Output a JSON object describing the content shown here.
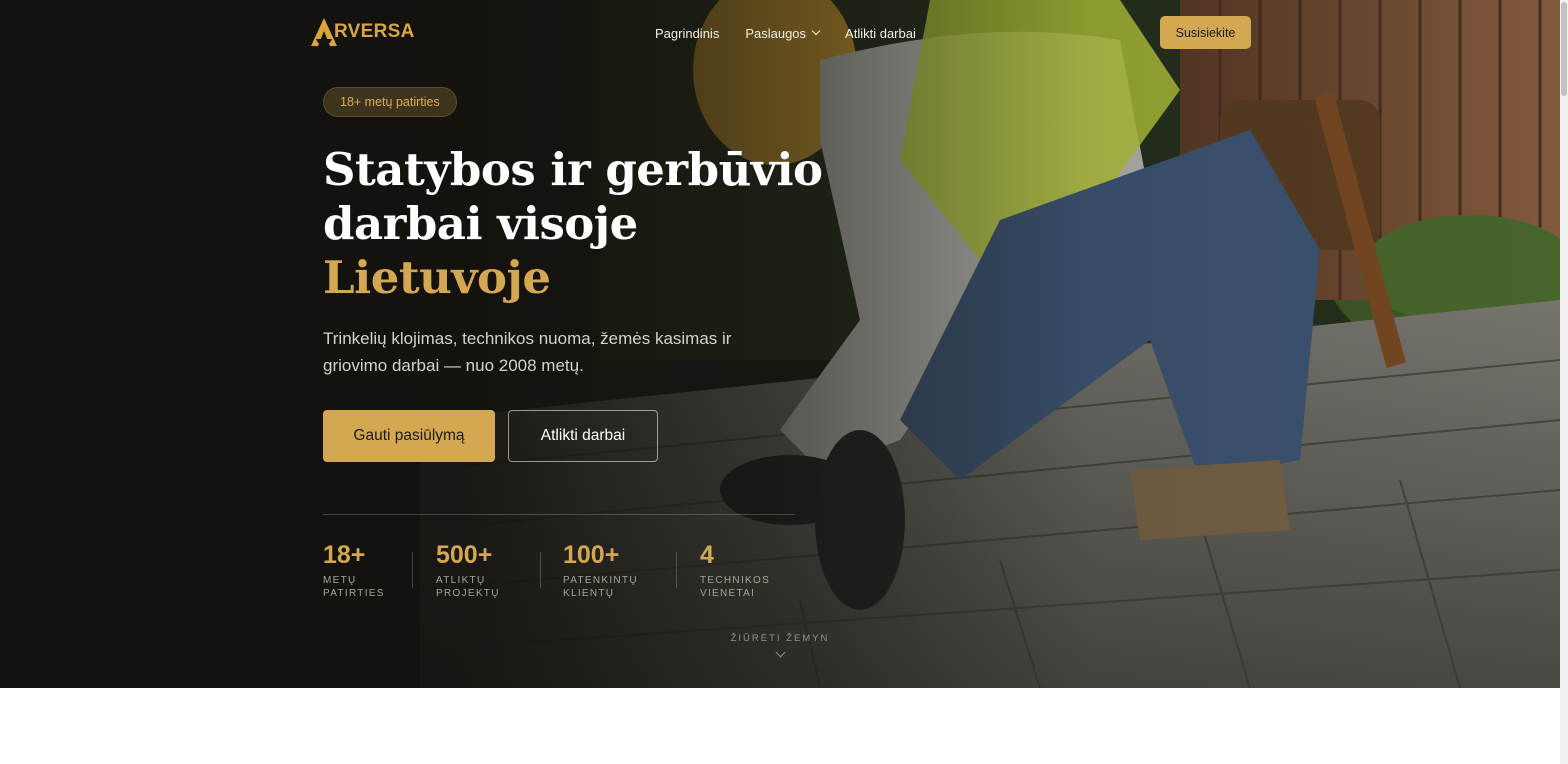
{
  "brand": {
    "name": "RVERSA",
    "accent_color": "#d4a851",
    "logo_icon": "a-triangle-logo"
  },
  "nav": {
    "items": [
      "Pagrindinis",
      "Paslaugos",
      "Atlikti darbai"
    ],
    "contact_label": "Susisiekite"
  },
  "hero": {
    "badge": "18+ metų patirties",
    "title_line1": "Statybos ir gerbūvio",
    "title_line2": "darbai visoje",
    "title_accent": "Lietuvoje",
    "subtitle": "Trinkelių klojimas, technikos nuoma, žemės kasimas ir griovimo darbai — nuo 2008 metų.",
    "primary_button": "Gauti pasiūlymą",
    "secondary_button": "Atlikti darbai"
  },
  "stats": [
    {
      "value": "18+",
      "label_line1": "Metų",
      "label_line2": "patirties"
    },
    {
      "value": "500+",
      "label_line1": "Atliktų",
      "label_line2": "projektų"
    },
    {
      "value": "100+",
      "label_line1": "Patenkintų",
      "label_line2": "klientų"
    },
    {
      "value": "4",
      "label_line1": "Technikos",
      "label_line2": "vienetai"
    }
  ],
  "scroll_hint": "ŽIŪRĖTI ŽEMYN"
}
